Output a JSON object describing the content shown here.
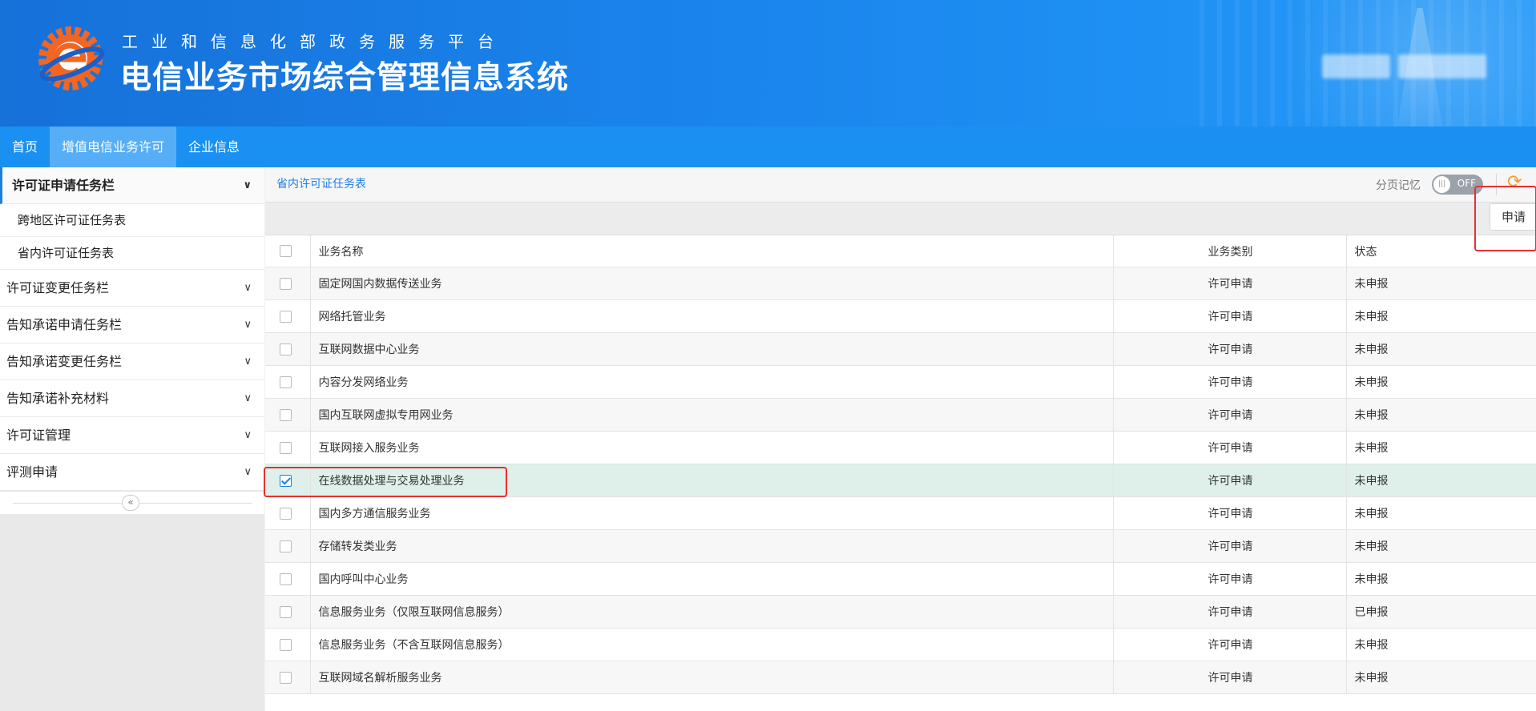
{
  "header": {
    "subtitle": "工业和信息化部政务服务平台",
    "title": "电信业务市场综合管理信息系统"
  },
  "nav": {
    "items": [
      "首页",
      "增值电信业务许可",
      "企业信息"
    ],
    "active": "增值电信业务许可"
  },
  "sidebar": {
    "groups": [
      {
        "label": "许可证申请任务栏",
        "open": true,
        "children": [
          "跨地区许可证任务表",
          "省内许可证任务表"
        ]
      },
      {
        "label": "许可证变更任务栏"
      },
      {
        "label": "告知承诺申请任务栏"
      },
      {
        "label": "告知承诺变更任务栏"
      },
      {
        "label": "告知承诺补充材料"
      },
      {
        "label": "许可证管理"
      },
      {
        "label": "评测申请"
      }
    ],
    "collapse_glyph": "«"
  },
  "main": {
    "active_tab": "省内许可证任务表",
    "page_memory_label": "分页记忆",
    "toggle_label": "OFF",
    "apply_button": "申请",
    "table": {
      "headers": {
        "name": "业务名称",
        "type": "业务类别",
        "status": "状态"
      },
      "rows": [
        {
          "name": "固定网国内数据传送业务",
          "type": "许可申请",
          "status": "未申报",
          "checked": false
        },
        {
          "name": "网络托管业务",
          "type": "许可申请",
          "status": "未申报",
          "checked": false
        },
        {
          "name": "互联网数据中心业务",
          "type": "许可申请",
          "status": "未申报",
          "checked": false
        },
        {
          "name": "内容分发网络业务",
          "type": "许可申请",
          "status": "未申报",
          "checked": false
        },
        {
          "name": "国内互联网虚拟专用网业务",
          "type": "许可申请",
          "status": "未申报",
          "checked": false
        },
        {
          "name": "互联网接入服务业务",
          "type": "许可申请",
          "status": "未申报",
          "checked": false
        },
        {
          "name": "在线数据处理与交易处理业务",
          "type": "许可申请",
          "status": "未申报",
          "checked": true
        },
        {
          "name": "国内多方通信服务业务",
          "type": "许可申请",
          "status": "未申报",
          "checked": false
        },
        {
          "name": "存储转发类业务",
          "type": "许可申请",
          "status": "未申报",
          "checked": false
        },
        {
          "name": "国内呼叫中心业务",
          "type": "许可申请",
          "status": "未申报",
          "checked": false
        },
        {
          "name": "信息服务业务（仅限互联网信息服务）",
          "type": "许可申请",
          "status": "已申报",
          "checked": false
        },
        {
          "name": "信息服务业务（不含互联网信息服务）",
          "type": "许可申请",
          "status": "未申报",
          "checked": false
        },
        {
          "name": "互联网域名解析服务业务",
          "type": "许可申请",
          "status": "未申报",
          "checked": false
        }
      ]
    }
  },
  "colors": {
    "header_blue": "#1a84ec",
    "nav_blue": "#1a90f2",
    "nav_active": "#56aef7",
    "selected_row": "#dff0ea",
    "highlight_red": "#e53030"
  }
}
